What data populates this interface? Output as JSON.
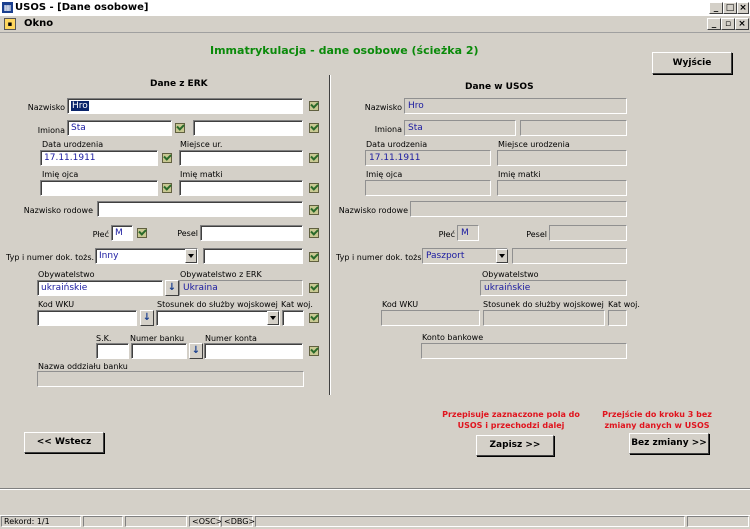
{
  "window": {
    "title": "USOS - [Dane osobowe]",
    "menu": "Okno"
  },
  "heading": "Immatrykulacja - dane osobowe (ścieżka 2)",
  "buttons": {
    "exit": "Wyjście",
    "back": "<< Wstecz",
    "save": "Zapisz >>",
    "no_change": "Bez zmiany >>"
  },
  "hints": {
    "save": "Przepisuje zaznaczone pola do USOS i przechodzi dalej",
    "no_change": "Przejście do kroku 3 bez zmiany danych w USOS"
  },
  "erk": {
    "section_title": "Dane z ERK",
    "labels": {
      "surname": "Nazwisko",
      "first_names": "Imiona",
      "birth_date": "Data urodzenia",
      "birth_place": "Miejsce ur.",
      "father_name": "Imię ojca",
      "mother_name": "Imię matki",
      "family_name": "Nazwisko rodowe",
      "sex": "Płeć",
      "pesel": "Pesel",
      "id_doc": "Typ i numer dok. tożs.",
      "citizenship": "Obywatelstwo",
      "citizenship_erk": "Obywatelstwo z ERK",
      "wku": "Kod WKU",
      "military": "Stosunek do służby wojskowej",
      "mil_cat": "Kat woj.",
      "sk": "S.K.",
      "bank_no": "Numer banku",
      "account_no": "Numer konta",
      "bank_branch": "Nazwa oddziału banku"
    },
    "values": {
      "surname": "Hro",
      "first_name": "Sta",
      "second_name": "",
      "birth_date": "17.11.1911",
      "birth_place": "",
      "father_name": "",
      "mother_name": "",
      "family_name": "",
      "sex": "M",
      "pesel": "",
      "id_doc_type": "Inny",
      "id_doc_number": "",
      "citizenship": "ukraińskie",
      "citizenship_erk": "Ukraina",
      "wku": "",
      "military": "",
      "mil_cat": "",
      "sk": "",
      "bank_no": "",
      "account_no": "",
      "bank_branch": ""
    }
  },
  "usos": {
    "section_title": "Dane w USOS",
    "labels": {
      "surname": "Nazwisko",
      "first_names": "Imiona",
      "birth_date": "Data urodzenia",
      "birth_place": "Miejsce urodzenia",
      "father_name": "Imię ojca",
      "mother_name": "Imię matki",
      "family_name": "Nazwisko rodowe",
      "sex": "Płeć",
      "pesel": "Pesel",
      "id_doc": "Typ i numer dok. tożs.",
      "citizenship": "Obywatelstwo",
      "wku": "Kod WKU",
      "military": "Stosunek do służby wojskowej",
      "mil_cat": "Kat woj.",
      "bank_account": "Konto bankowe"
    },
    "values": {
      "surname": "Hro",
      "first_name": "Sta",
      "birth_date": "17.11.1911",
      "sex": "M",
      "id_doc_type": "Paszport",
      "citizenship": "ukraińskie"
    }
  },
  "status": {
    "record": "Rekord: 1/1",
    "osc": "<OSC>",
    "dbg": "<DBG>"
  },
  "colors": {
    "background": "#d4d0c8",
    "heading": "#0a8a0a",
    "hint": "#e0141e",
    "value_text": "#1a1aa0"
  }
}
